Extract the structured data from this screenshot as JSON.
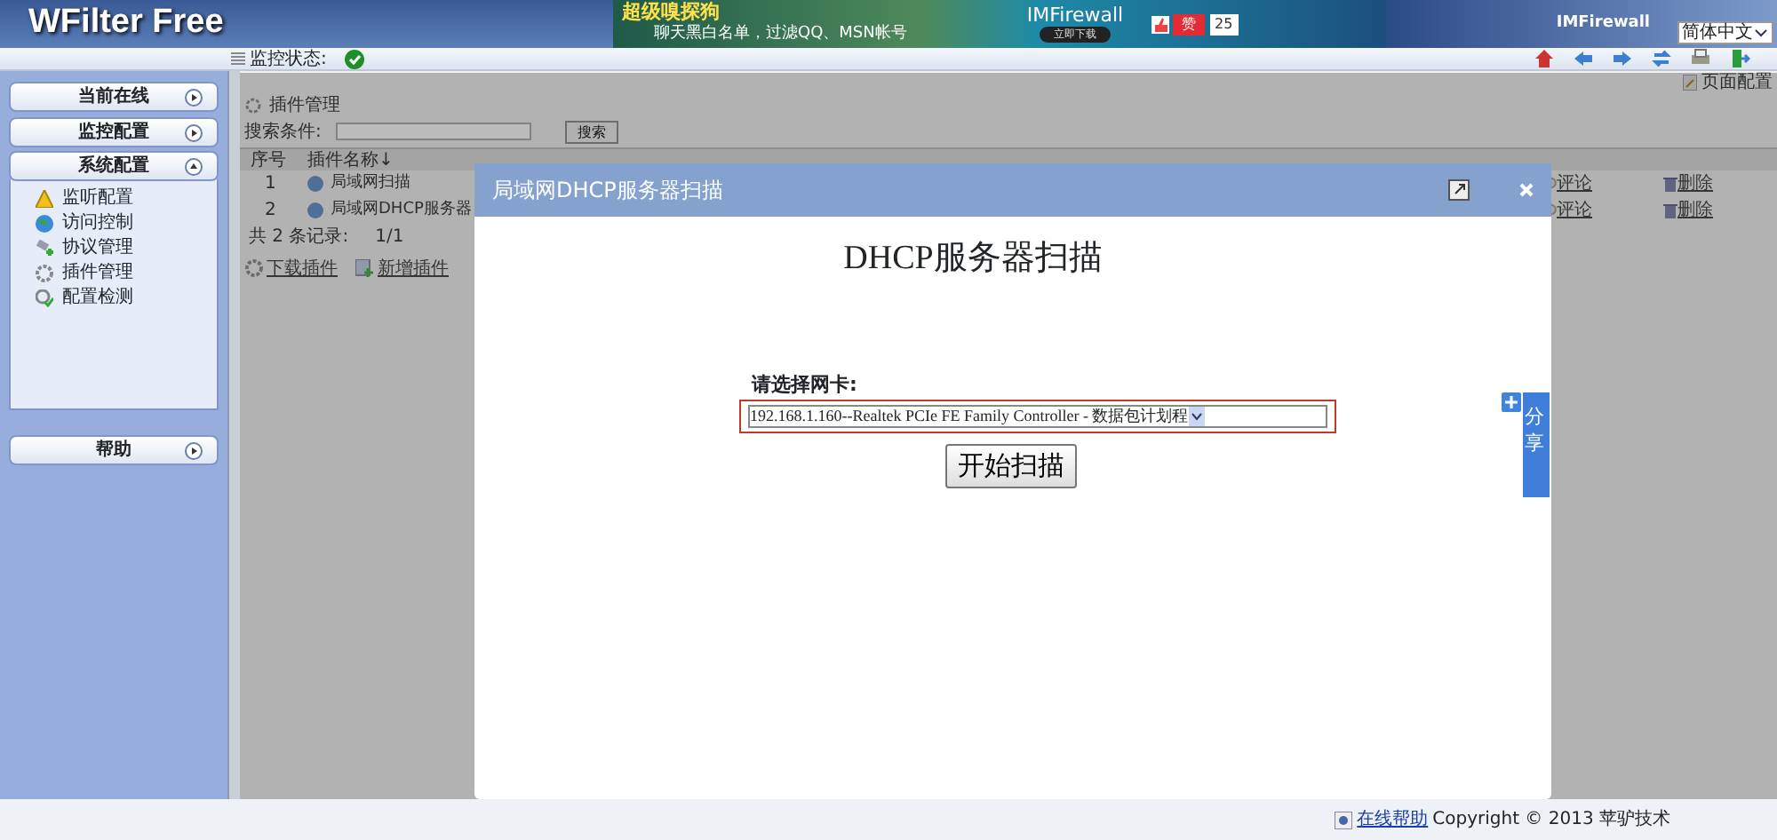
{
  "header": {
    "app_title": "WFilter Free",
    "banner": {
      "headline": "超级嗅探狗",
      "tagline": "聊天黑白名单，过滤QQ、MSN帐号",
      "product": "IMFirewall",
      "download": "立即下载",
      "like": "赞",
      "like_count": "25"
    },
    "brand": "IMFirewall",
    "language": "简体中文"
  },
  "toolbar": {
    "status_label": "监控状态:",
    "monitoring_on": true,
    "page_config": "页面配置"
  },
  "sidebar": {
    "sections": [
      {
        "label": "当前在线",
        "expanded": false
      },
      {
        "label": "监控配置",
        "expanded": false
      },
      {
        "label": "系统配置",
        "expanded": true,
        "children": [
          {
            "label": "监听配置"
          },
          {
            "label": "访问控制"
          },
          {
            "label": "协议管理"
          },
          {
            "label": "插件管理"
          },
          {
            "label": "配置检测"
          }
        ]
      },
      {
        "label": "帮助",
        "expanded": false
      }
    ]
  },
  "content": {
    "title": "插件管理",
    "search_label": "搜索条件:",
    "search_button": "搜索",
    "columns": [
      "序号",
      "插件名称↓"
    ],
    "rows": [
      {
        "index": "1",
        "name": "局域网扫描",
        "comment": "评论",
        "delete": "删除"
      },
      {
        "index": "2",
        "name": "局域网DHCP服务器",
        "comment": "评论",
        "delete": "删除"
      }
    ],
    "record_count": "共 2 条记录:",
    "pages": "1/1",
    "actions": [
      "下载插件",
      "新增插件"
    ]
  },
  "dialog": {
    "title": "局域网DHCP服务器扫描",
    "heading": "DHCP服务器扫描",
    "nic_label": "请选择网卡:",
    "nic_value": "192.168.1.160--Realtek PCIe FE Family Controller - 数据包计划程",
    "start_button": "开始扫描"
  },
  "share": {
    "label": "分享"
  },
  "footer": {
    "help_link": "在线帮助",
    "copyright": "Copyright © 2013 苹驴技术"
  }
}
